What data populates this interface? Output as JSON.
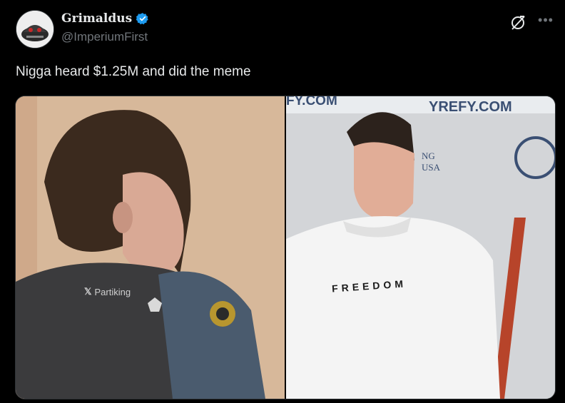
{
  "post": {
    "author_name": "Grimaldus",
    "handle": "@ImperiumFirst",
    "text": "Nigga heard $1.25M and did the meme"
  },
  "icons": {
    "verified": "verified-badge-icon",
    "grok": "grok-icon",
    "more": "more-options-icon",
    "x_logo": "x-logo-icon"
  },
  "media": {
    "watermark": "Partiking",
    "banner_left_text": "FY.COM",
    "banner_right_text": "YREFY.COM",
    "banner_side_text_1": "NG",
    "banner_side_text_2": "USA",
    "shirt_text": "FREEDOM"
  },
  "colors": {
    "background": "#000000",
    "text_primary": "#e7e9ea",
    "text_secondary": "#71767b",
    "verified_blue": "#1d9bf0"
  }
}
